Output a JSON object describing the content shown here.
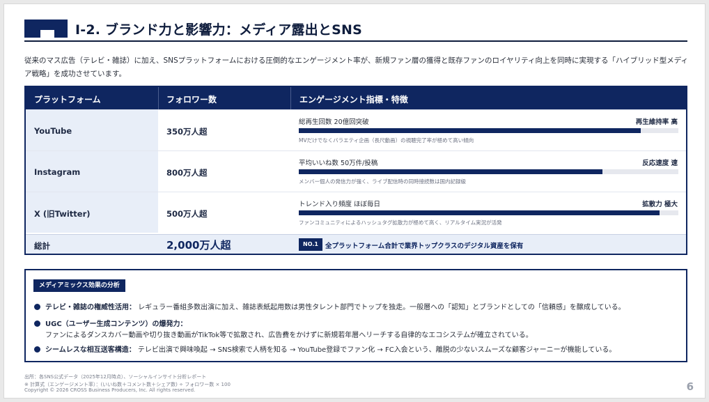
{
  "header": {
    "title": "I-2. ブランド力と影響力：メディア露出とSNS"
  },
  "intro": "従来のマス広告（テレビ・雑誌）に加え、SNSプラットフォームにおける圧倒的なエンゲージメント率が、新規ファン層の獲得と既存ファンのロイヤリティ向上を同時に実現する「ハイブリッド型メディア戦略」を成功させています。",
  "table": {
    "columns": [
      "プラットフォーム",
      "フォロワー数",
      "エンゲージメント指標・特徴"
    ],
    "rows": [
      {
        "platform": "YouTube",
        "followers": "350万人超",
        "metric_label": "総再生回数 20億回突破",
        "metric_tag": "再生維持率 高",
        "level": 0.9,
        "note": "MVだけでなくバラエティ企画（長尺動画）の視聴完了率が極めて高い傾向"
      },
      {
        "platform": "Instagram",
        "followers": "800万人超",
        "metric_label": "平均いいね数 50万件/投稿",
        "metric_tag": "反応速度 速",
        "level": 0.8,
        "note": "メンバー個人の発信力が強く、ライブ配信時の同時接続数は国内記録級"
      },
      {
        "platform": "X (旧Twitter)",
        "followers": "500万人超",
        "metric_label": "トレンド入り頻度 ほぼ毎日",
        "metric_tag": "拡散力 極大",
        "level": 0.95,
        "note": "ファンコミュニティによるハッシュタグ拡散力が極めて高く、リアルタイム実況が活発"
      }
    ],
    "total": {
      "label": "総計",
      "value": "2,000万人超",
      "badge": "NO.1",
      "note": "全プラットフォーム合計で業界トップクラスのデジタル資産を保有"
    }
  },
  "media_mix": {
    "tag": "メディアミックス効果の分析",
    "items": [
      {
        "title": "テレビ・雑誌の権威性活用：",
        "text": "レギュラー番組多数出演に加え、雑誌表紙起用数は男性タレント部門でトップを独走。一般層への「認知」とブランドとしての「信頼感」を醸成している。"
      },
      {
        "title": "UGC（ユーザー生成コンテンツ）の爆発力：",
        "text": "ファンによるダンスカバー動画や切り抜き動画がTikTok等で拡散され、広告費をかけずに新規若年層へリーチする自律的なエコシステムが確立されている。"
      },
      {
        "title": "シームレスな相互送客構造：",
        "text": "テレビ出演で興味喚起 → SNS検索で人柄を知る → YouTube登録でファン化 → FC入会という、離脱の少ないスムーズな顧客ジャーニーが機能している。"
      }
    ]
  },
  "footer": {
    "source": "出所：各SNS公式データ（2025年12月時点）、ソーシャルインサイト分析レポート",
    "formula": "※ 計算式（エンゲージメント率）：(いいね数＋コメント数＋シェア数) ÷ フォロワー数 × 100",
    "copyright": "Copyright © 2026 CROSS Business Producers, Inc. All rights reserved.",
    "page": "6"
  }
}
